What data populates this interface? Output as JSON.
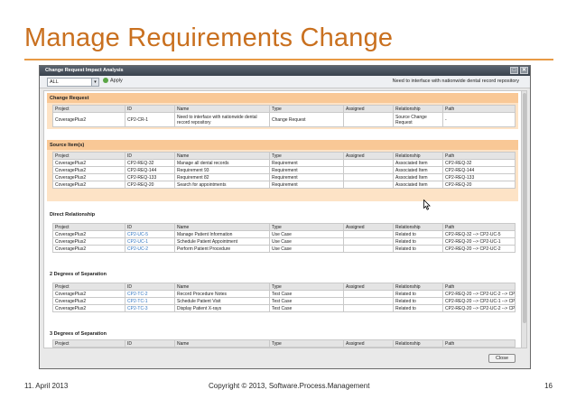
{
  "slide": {
    "title": "Manage Requirements Change",
    "footer_date": "11. April 2013",
    "footer_copyright": "Copyright © 2013, Software.Process.Management",
    "page_number": "16"
  },
  "dialog": {
    "title": "Change Request Impact Analysis",
    "minimize_glyph": "□",
    "close_glyph": "✕",
    "filter_value": "ALL",
    "apply_label": "Apply",
    "selected_request_text": "Need to interface with nationwide dental record repository",
    "close_label": "Close"
  },
  "columns": [
    "Project",
    "ID",
    "Name",
    "Type",
    "Assigned",
    "Relationship",
    "Path"
  ],
  "sections": {
    "change_request": {
      "title": "Change Request",
      "rows": [
        [
          "CoveragePlus2",
          "CP2-CR-1",
          "Need to interface with nationwide dental record repository",
          "Change Request",
          "",
          "Source Change Request",
          "-"
        ]
      ]
    },
    "source_items": {
      "title": "Source Item(s)",
      "rows": [
        [
          "CoveragePlus2",
          "CP2-REQ-32",
          "Manage all dental records",
          "Requirement",
          "",
          "Associated Item",
          "CP2-REQ-32"
        ],
        [
          "CoveragePlus2",
          "CP2-REQ-144",
          "Requirement 93",
          "Requirement",
          "",
          "Associated Item",
          "CP2-REQ-144"
        ],
        [
          "CoveragePlus2",
          "CP2-REQ-133",
          "Requirement 82",
          "Requirement",
          "",
          "Associated Item",
          "CP2-REQ-133"
        ],
        [
          "CoveragePlus2",
          "CP2-REQ-20",
          "Search for appointments",
          "Requirement",
          "",
          "Associated Item",
          "CP2-REQ-20"
        ]
      ]
    },
    "direct_relationship": {
      "title": "Direct Relationship",
      "rows": [
        [
          "CoveragePlus2",
          "CP2-UC-5",
          "Manage Patient Information",
          "Use Case",
          "",
          "Related to",
          "CP2-REQ-32 --> CP2-UC-5"
        ],
        [
          "CoveragePlus2",
          "CP2-UC-1",
          "Schedule Patient Appointment",
          "Use Case",
          "",
          "Related to",
          "CP2-REQ-20 --> CP2-UC-1"
        ],
        [
          "CoveragePlus2",
          "CP2-UC-2",
          "Perform Patient Procedure",
          "Use Case",
          "",
          "Related to",
          "CP2-REQ-20 --> CP2-UC-2"
        ]
      ]
    },
    "two_degrees": {
      "title": "2 Degrees of Separation",
      "rows": [
        [
          "CoveragePlus2",
          "CP2-TC-2",
          "Record Procedure Notes",
          "Test Case",
          "",
          "Related to",
          "CP2-REQ-20 --> CP2-UC-2 --> CP2-TC-"
        ],
        [
          "CoveragePlus2",
          "CP2-TC-1",
          "Schedule Patient Visit",
          "Test Case",
          "",
          "Related to",
          "CP2-REQ-20 --> CP2-UC-1 --> CP2-TC-"
        ],
        [
          "CoveragePlus2",
          "CP2-TC-3",
          "Display Patient X-rays",
          "Test Case",
          "",
          "Related to",
          "CP2-REQ-20 --> CP2-UC-2 --> CP2-TC-"
        ]
      ]
    },
    "three_degrees": {
      "title": "3 Degrees of Separation",
      "rows": []
    }
  },
  "colors": {
    "title_orange": "#c9701f",
    "section_header": "#f9c896",
    "section_fill": "#fde3c6",
    "link_blue": "#2f74c0"
  }
}
